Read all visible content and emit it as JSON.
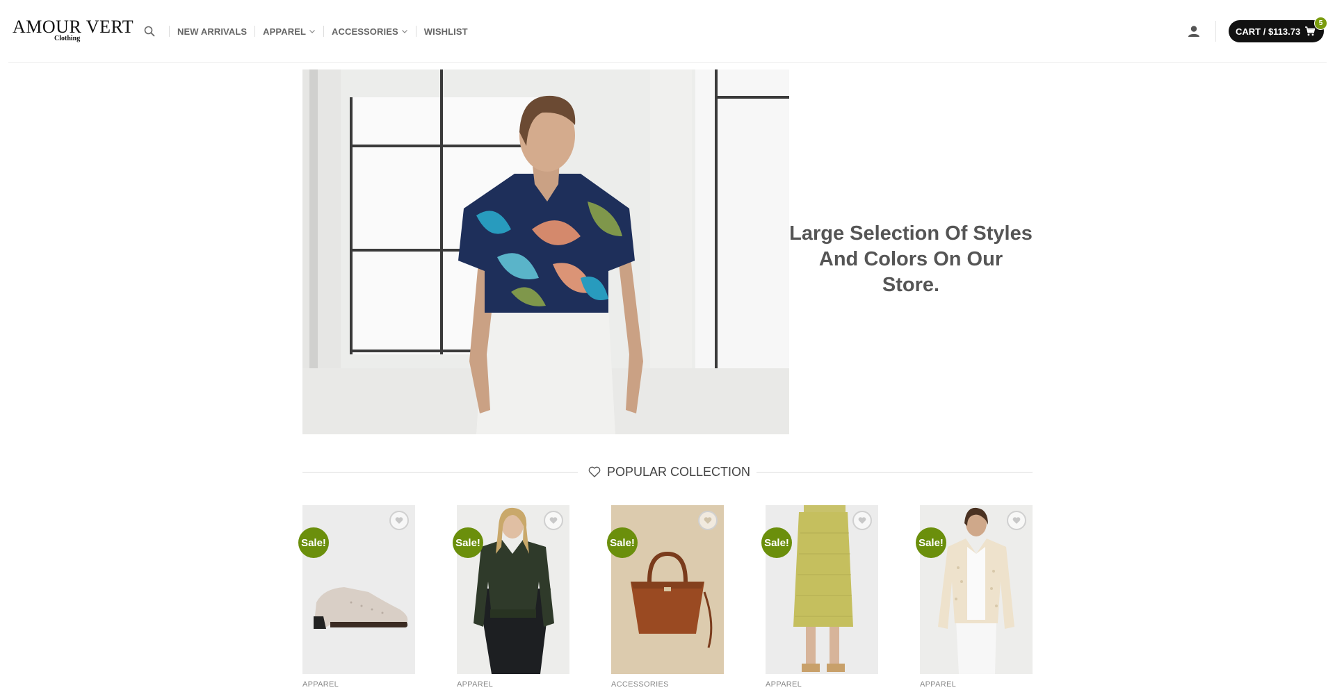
{
  "brand": {
    "name": "AMOUR VERT",
    "subtitle": "Clothing"
  },
  "nav": {
    "search_icon": "search-icon",
    "items": [
      {
        "label": "NEW ARRIVALS",
        "has_dropdown": false
      },
      {
        "label": "APPAREL",
        "has_dropdown": true
      },
      {
        "label": "ACCESSORIES",
        "has_dropdown": true
      },
      {
        "label": "WISHLIST",
        "has_dropdown": false
      }
    ]
  },
  "header": {
    "account_icon": "user-icon",
    "cart_label": "CART / $113.73",
    "cart_count": "5",
    "cart_icon": "cart-icon"
  },
  "hero": {
    "headline_line1": "Large Selection Of Styles",
    "headline_line2": "And Colors On Our Store."
  },
  "popular": {
    "title": "POPULAR COLLECTION",
    "icon": "heart-icon"
  },
  "products": [
    {
      "badge": "Sale!",
      "category": "APPAREL",
      "image": "shoe"
    },
    {
      "badge": "Sale!",
      "category": "APPAREL",
      "image": "bomber-jacket"
    },
    {
      "badge": "Sale!",
      "category": "ACCESSORIES",
      "image": "handbag"
    },
    {
      "badge": "Sale!",
      "category": "APPAREL",
      "image": "knit-skirt"
    },
    {
      "badge": "Sale!",
      "category": "APPAREL",
      "image": "cardigan"
    }
  ],
  "colors": {
    "cart_bg": "#111111",
    "sale_green": "#6b8f0c",
    "badge_green": "#7a9c0f",
    "text_gray": "#555555"
  }
}
